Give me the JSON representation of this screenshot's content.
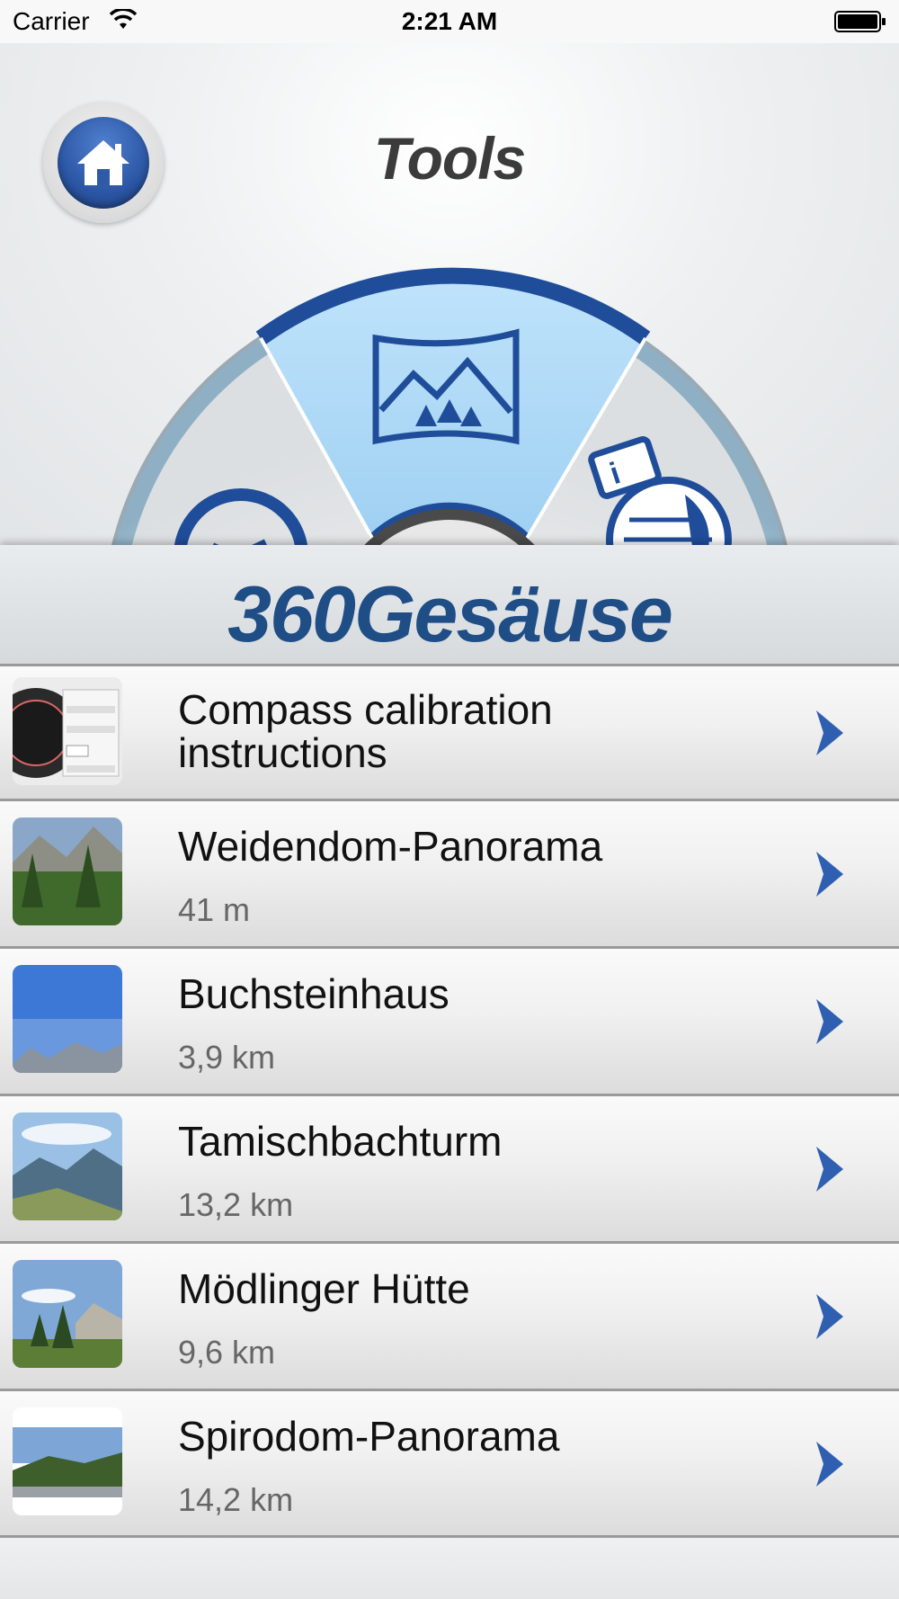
{
  "status_bar": {
    "carrier": "Carrier",
    "time": "2:21 AM"
  },
  "header": {
    "title": "Tools"
  },
  "banner": {
    "brand": "360Gesäuse"
  },
  "list": {
    "items": [
      {
        "title_line1": "Compass calibration",
        "title_line2": "instructions",
        "thumbnail": "compass-screenshot"
      },
      {
        "title": "Weidendom-Panorama",
        "distance": "41 m",
        "thumbnail": "forest-panorama"
      },
      {
        "title": "Buchsteinhaus",
        "distance": "3,9 km",
        "thumbnail": "sky-mountain-panorama"
      },
      {
        "title": "Tamischbachturm",
        "distance": "13,2 km",
        "thumbnail": "valley-panorama"
      },
      {
        "title": "Mödlinger Hütte",
        "distance": "9,6 km",
        "thumbnail": "meadow-trees-panorama"
      },
      {
        "title": "Spirodom-Panorama",
        "distance": "14,2 km",
        "thumbnail": "road-hill-panorama"
      }
    ]
  },
  "colors": {
    "brand_blue": "#1f4d86",
    "accent_blue": "#2e5aa8",
    "highlight": "#bfe3fb"
  },
  "icons": [
    "wifi-icon",
    "battery-icon",
    "home-icon",
    "panorama-icon",
    "clock-icon",
    "info-map-icon",
    "chevron-right-icon"
  ]
}
